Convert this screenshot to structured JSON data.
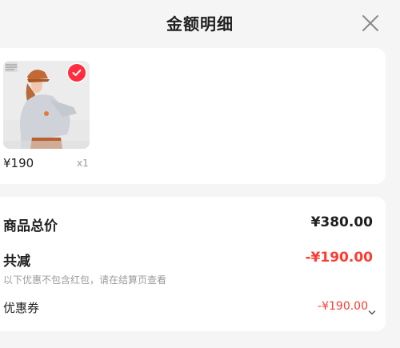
{
  "header": {
    "title": "金额明细",
    "close_icon": "close-icon"
  },
  "product": {
    "price": "¥190",
    "quantity": "x1",
    "selected": true,
    "check_color": "#ff2d3d"
  },
  "summary": {
    "total_label": "商品总价",
    "total_value": "¥380.00",
    "discount_label": "共减",
    "discount_value": "-¥190.00",
    "discount_color": "#ff3b30",
    "note": "以下优惠不包含红包，请在结算页查看",
    "coupon_label": "优惠券",
    "coupon_value": "-¥190.00",
    "coupon_icon": "chevron-down-icon"
  }
}
